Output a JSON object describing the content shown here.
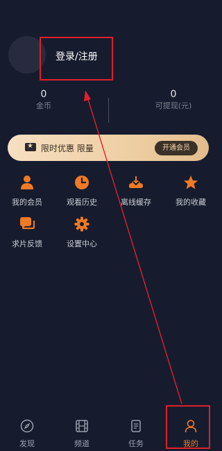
{
  "login": {
    "label": "登录/注册"
  },
  "stats": {
    "coins": {
      "value": "0",
      "label": "金币"
    },
    "cash": {
      "value": "0",
      "label": "可提现(元)"
    }
  },
  "banner": {
    "text": "限时优惠 限量",
    "button": "开通会员"
  },
  "menu": [
    {
      "label": "我的会员",
      "icon": "person-icon"
    },
    {
      "label": "观看历史",
      "icon": "clock-icon"
    },
    {
      "label": "离线缓存",
      "icon": "download-cloud-icon"
    },
    {
      "label": "我的收藏",
      "icon": "star-icon"
    },
    {
      "label": "求片反馈",
      "icon": "chat-icon"
    },
    {
      "label": "设置中心",
      "icon": "gear-icon"
    }
  ],
  "tabs": [
    {
      "label": "发现",
      "icon": "compass-icon"
    },
    {
      "label": "频道",
      "icon": "film-icon"
    },
    {
      "label": "任务",
      "icon": "task-icon"
    },
    {
      "label": "我的",
      "icon": "user-icon",
      "active": true
    }
  ],
  "colors": {
    "background": "#161c2e",
    "accent": "#f07a24",
    "annotation": "#e0202a",
    "banner_gold": "#eecfa4"
  }
}
